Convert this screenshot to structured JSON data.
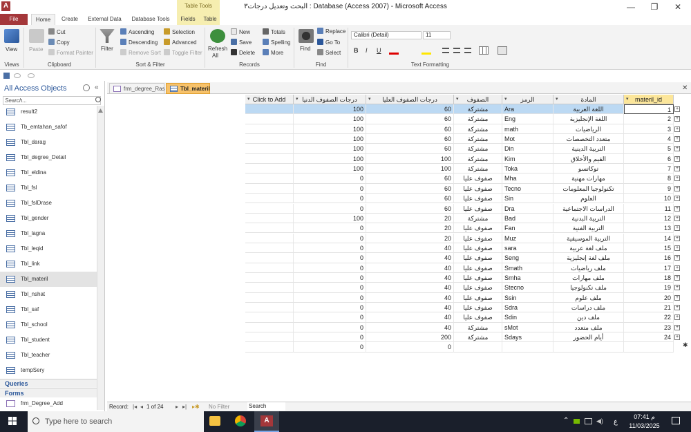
{
  "window": {
    "title": "البحث وتعديل درجات٣ : Database (Access 2007) - Microsoft Access",
    "app_icon": "A",
    "controls": {
      "minimize": "—",
      "maximize": "❐",
      "close": "✕"
    }
  },
  "ribbon_tabs": {
    "file": "File",
    "home": "Home",
    "create": "Create",
    "external": "External Data",
    "dbtools": "Database Tools",
    "fields": "Fields",
    "table": "Table",
    "context_label": "Table Tools"
  },
  "ribbon": {
    "views": {
      "view": "View",
      "label": "Views"
    },
    "clipboard": {
      "paste": "Paste",
      "cut": "Cut",
      "copy": "Copy",
      "format_painter": "Format Painter",
      "label": "Clipboard"
    },
    "sort_filter": {
      "filter": "Filter",
      "ascending": "Ascending",
      "descending": "Descending",
      "remove_sort": "Remove Sort",
      "selection": "Selection",
      "advanced": "Advanced",
      "toggle_filter": "Toggle Filter",
      "label": "Sort & Filter"
    },
    "records": {
      "refresh": "Refresh",
      "refresh_sub": "All",
      "new": "New",
      "save": "Save",
      "delete": "Delete",
      "totals": "Totals",
      "spelling": "Spelling",
      "more": "More",
      "label": "Records"
    },
    "find": {
      "find": "Find",
      "replace": "Replace",
      "goto": "Go To",
      "select": "Select",
      "label": "Find"
    },
    "text_formatting": {
      "font": "Calibri (Detail)",
      "size": "11",
      "bold": "B",
      "italic": "I",
      "underline": "U",
      "label": "Text Formatting"
    }
  },
  "nav_pane": {
    "header": "All Access Objects",
    "search_placeholder": "Search...",
    "items": [
      "result2",
      "Tb_emtahan_safof",
      "Tbl_darag",
      "Tbl_degree_Detail",
      "Tbl_eldina",
      "Tbl_fsl",
      "Tbl_fslDrase",
      "Tbl_gender",
      "Tbl_lagna",
      "Tbl_leqid",
      "Tbl_link",
      "Tbl_materil",
      "Tbl_nshat",
      "Tbl_saf",
      "Tbl_school",
      "Tbl_student",
      "Tbl_teacher",
      "tempSery"
    ],
    "selected_item": "Tbl_materil",
    "queries": "Queries",
    "forms": "Forms",
    "form_item": "frm_Degree_Add"
  },
  "doc_tabs": [
    "frm_degree_Ras",
    "Tbl_materil"
  ],
  "datasheet": {
    "columns": {
      "click_to_add": "Click to Add",
      "degree_low": "درجات الصفوف الدنيا",
      "degree_high": "درجات الصفوف العليا",
      "grades": "الصفوف",
      "code": "الرمز",
      "subject": "المادة",
      "id": "materil_id"
    },
    "rows": [
      {
        "low": "100",
        "high": "60",
        "grades": "مشتركة",
        "code": "Ara",
        "subject": "اللغة العربية",
        "id": "1"
      },
      {
        "low": "100",
        "high": "60",
        "grades": "مشتركة",
        "code": "Eng",
        "subject": "اللغة الإنجليزية",
        "id": "2"
      },
      {
        "low": "100",
        "high": "60",
        "grades": "مشتركة",
        "code": "math",
        "subject": "الرياضيات",
        "id": "3"
      },
      {
        "low": "100",
        "high": "60",
        "grades": "مشتركة",
        "code": "Mot",
        "subject": "متعدد التخصصات",
        "id": "4"
      },
      {
        "low": "100",
        "high": "60",
        "grades": "مشتركة",
        "code": "Din",
        "subject": "التربية الدينية",
        "id": "5"
      },
      {
        "low": "100",
        "high": "100",
        "grades": "مشتركة",
        "code": "Kim",
        "subject": "القيم والأخلاق",
        "id": "6"
      },
      {
        "low": "100",
        "high": "100",
        "grades": "مشتركة",
        "code": "Toka",
        "subject": "توكاتسو",
        "id": "7"
      },
      {
        "low": "0",
        "high": "60",
        "grades": "صفوف عليا",
        "code": "Mha",
        "subject": "مهارات مهنية",
        "id": "8"
      },
      {
        "low": "0",
        "high": "60",
        "grades": "صفوف عليا",
        "code": "Tecno",
        "subject": "تكنولوجيا المعلومات",
        "id": "9"
      },
      {
        "low": "0",
        "high": "60",
        "grades": "صفوف عليا",
        "code": "Sin",
        "subject": "العلوم",
        "id": "10"
      },
      {
        "low": "0",
        "high": "60",
        "grades": "صفوف عليا",
        "code": "Dra",
        "subject": "الدراسات الاجتماعية",
        "id": "11"
      },
      {
        "low": "100",
        "high": "20",
        "grades": "مشتركة",
        "code": "Bad",
        "subject": "التربية البدنية",
        "id": "12"
      },
      {
        "low": "0",
        "high": "20",
        "grades": "صفوف عليا",
        "code": "Fan",
        "subject": "التربية الفنية",
        "id": "13"
      },
      {
        "low": "0",
        "high": "20",
        "grades": "صفوف عليا",
        "code": "Muz",
        "subject": "التربية الموسيقية",
        "id": "14"
      },
      {
        "low": "0",
        "high": "40",
        "grades": "صفوف عليا",
        "code": "sara",
        "subject": "ملف لغة عربية",
        "id": "15"
      },
      {
        "low": "0",
        "high": "40",
        "grades": "صفوف عليا",
        "code": "Seng",
        "subject": "ملف لغة إنجليزية",
        "id": "16"
      },
      {
        "low": "0",
        "high": "40",
        "grades": "صفوف عليا",
        "code": "Smath",
        "subject": "ملف رياضيات",
        "id": "17"
      },
      {
        "low": "0",
        "high": "40",
        "grades": "صفوف عليا",
        "code": "Smha",
        "subject": "ملف مهارات",
        "id": "18"
      },
      {
        "low": "0",
        "high": "40",
        "grades": "صفوف عليا",
        "code": "Stecno",
        "subject": "ملف تكنولوجيا",
        "id": "19"
      },
      {
        "low": "0",
        "high": "40",
        "grades": "صفوف عليا",
        "code": "Ssin",
        "subject": "ملف علوم",
        "id": "20"
      },
      {
        "low": "0",
        "high": "40",
        "grades": "صفوف عليا",
        "code": "Sdra",
        "subject": "ملف دراسات",
        "id": "21"
      },
      {
        "low": "0",
        "high": "40",
        "grades": "صفوف عليا",
        "code": "Sdin",
        "subject": "ملف دين",
        "id": "22"
      },
      {
        "low": "0",
        "high": "40",
        "grades": "مشتركة",
        "code": "sMot",
        "subject": "ملف متعدد",
        "id": "23"
      },
      {
        "low": "0",
        "high": "200",
        "grades": "مشتركة",
        "code": "Sdays",
        "subject": "أيام الحضور",
        "id": "24"
      },
      {
        "low": "0",
        "high": "0",
        "grades": "",
        "code": "",
        "subject": "",
        "id": ""
      }
    ]
  },
  "record_nav": {
    "label": "Record:",
    "position": "1 of 24",
    "filter": "No Filter",
    "search": "Search"
  },
  "taskbar": {
    "search_placeholder": "Type here to search",
    "time": "07:41 م",
    "date": "11/03/2025",
    "lang": "ع"
  }
}
